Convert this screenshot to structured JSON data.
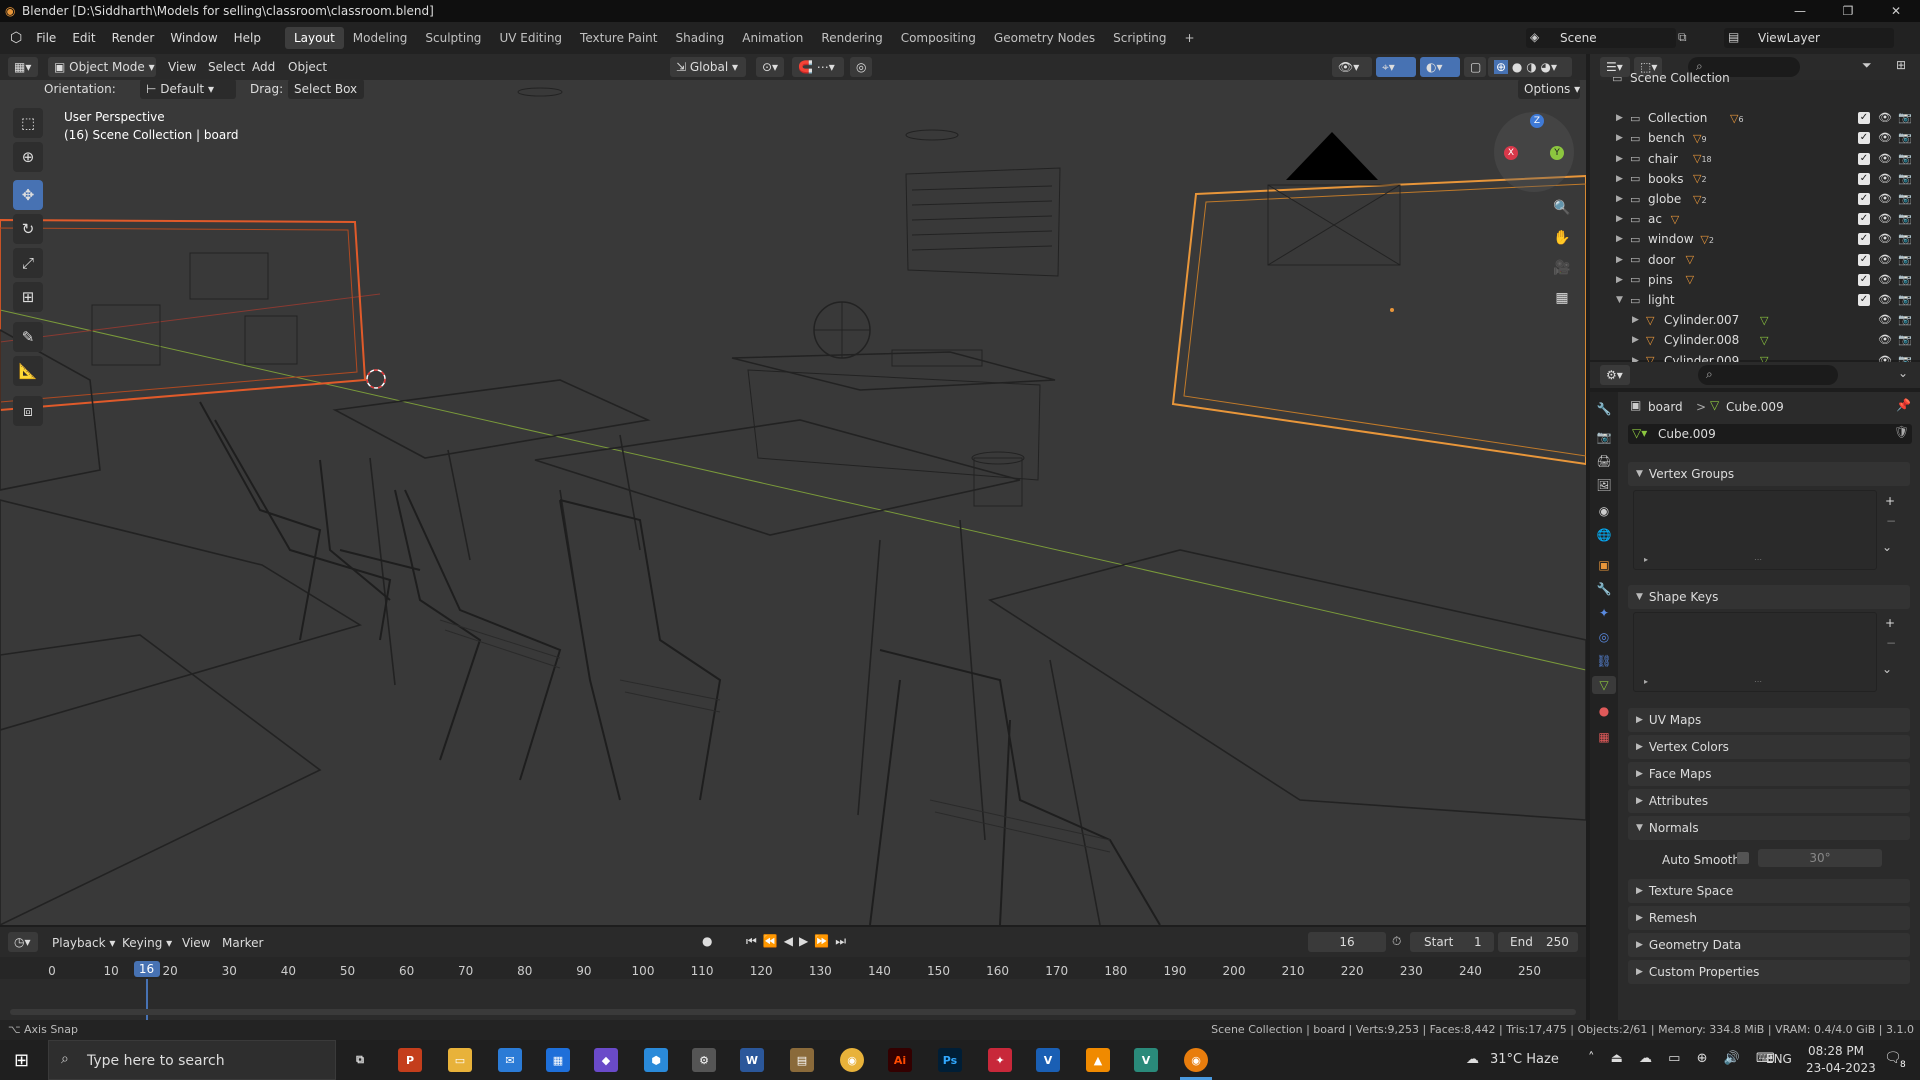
{
  "window": {
    "title": "Blender [D:\\Siddharth\\Models for selling\\classroom\\classroom.blend]",
    "minimize": "—",
    "maximize": "❐",
    "close": "✕"
  },
  "menubar": {
    "menus": [
      "File",
      "Edit",
      "Render",
      "Window",
      "Help"
    ],
    "workspaces": [
      "Layout",
      "Modeling",
      "Sculpting",
      "UV Editing",
      "Texture Paint",
      "Shading",
      "Animation",
      "Rendering",
      "Compositing",
      "Geometry Nodes",
      "Scripting"
    ],
    "active_workspace": "Layout",
    "add_workspace": "+",
    "scene_label": "Scene",
    "viewlayer_label": "ViewLayer"
  },
  "viewport_header": {
    "mode": "Object Mode",
    "menus": [
      "View",
      "Select",
      "Add",
      "Object"
    ],
    "transform_orientation": "Global",
    "options": "Options"
  },
  "tool_settings": {
    "orientation_label": "Orientation:",
    "orientation_value": "Default",
    "drag_label": "Drag:",
    "drag_value": "Select Box"
  },
  "viewport": {
    "perspective_text": "User Perspective",
    "collection_text": "(16) Scene Collection | board",
    "gizmo_axes": {
      "x": "X",
      "y": "Y",
      "z": "Z"
    }
  },
  "outliner": {
    "root": "Scene Collection",
    "items": [
      {
        "name": "Collection",
        "count": "6"
      },
      {
        "name": "bench",
        "count": "9"
      },
      {
        "name": "chair",
        "count": "18"
      },
      {
        "name": "books",
        "count": "2"
      },
      {
        "name": "globe",
        "count": "2"
      },
      {
        "name": "ac",
        "count": ""
      },
      {
        "name": "window",
        "count": "2"
      },
      {
        "name": "door",
        "count": ""
      },
      {
        "name": "pins",
        "count": ""
      },
      {
        "name": "light",
        "count": ""
      }
    ],
    "children": [
      "Cylinder.007",
      "Cylinder.008",
      "Cylinder.009"
    ]
  },
  "properties": {
    "breadcrumb_object": "board",
    "breadcrumb_sep": ">",
    "breadcrumb_data": "Cube.009",
    "datablock_name": "Cube.009",
    "panels": {
      "vertex_groups": "Vertex Groups",
      "shape_keys": "Shape Keys",
      "uv_maps": "UV Maps",
      "vertex_colors": "Vertex Colors",
      "face_maps": "Face Maps",
      "attributes": "Attributes",
      "normals": "Normals",
      "texture_space": "Texture Space",
      "remesh": "Remesh",
      "geometry_data": "Geometry Data",
      "custom_properties": "Custom Properties"
    },
    "auto_smooth_label": "Auto Smooth",
    "auto_smooth_angle": "30°"
  },
  "timeline": {
    "menus": [
      "Playback",
      "Keying",
      "View",
      "Marker"
    ],
    "current_frame": "16",
    "start_label": "Start",
    "start_value": "1",
    "end_label": "End",
    "end_value": "250",
    "ticks": [
      "0",
      "10",
      "20",
      "30",
      "40",
      "50",
      "60",
      "70",
      "80",
      "90",
      "100",
      "110",
      "120",
      "130",
      "140",
      "150",
      "160",
      "170",
      "180",
      "190",
      "200",
      "210",
      "220",
      "230",
      "240",
      "250"
    ],
    "playhead_label": "16"
  },
  "statusbar": {
    "left": "Axis Snap",
    "right": "Scene Collection | board | Verts:9,253 | Faces:8,442 | Tris:17,475 | Objects:2/61 | Memory: 334.8 MiB | VRAM: 0.4/4.0 GiB | 3.1.0"
  },
  "taskbar": {
    "search_placeholder": "Type here to search",
    "weather": "31°C  Haze",
    "language": "ENG",
    "time": "08:28 PM",
    "date": "23-04-2023",
    "notification_count": "8"
  },
  "colors": {
    "accent": "#4772b3",
    "selection_orange": "#e8963a",
    "active_red": "#e05a2a",
    "axis_x": "#d9384a",
    "axis_y": "#8cc63f",
    "axis_z": "#3f7ad6"
  }
}
